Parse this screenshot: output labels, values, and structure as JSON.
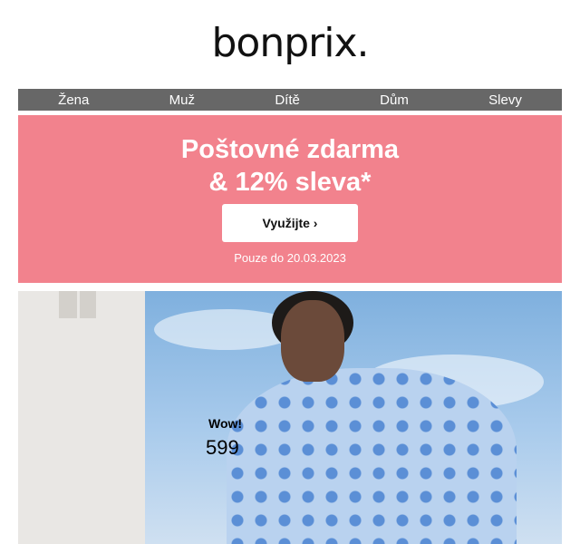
{
  "brand": {
    "logo": "bonprix."
  },
  "nav": {
    "items": [
      "Žena",
      "Muž",
      "Dítě",
      "Dům",
      "Slevy"
    ]
  },
  "promo": {
    "title_line1": "Poštovné zdarma",
    "title_line2": "& 12% sleva*",
    "cta_label": "Využijte ›",
    "valid_until": "Pouze do 20.03.2023",
    "bg_color": "#f2828d"
  },
  "hero": {
    "badge": "Wow!",
    "price": "599"
  }
}
